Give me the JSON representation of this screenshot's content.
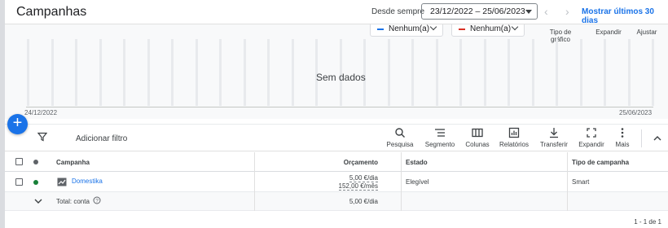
{
  "header": {
    "title": "Campanhas",
    "since_label": "Desde sempre",
    "date_range": "23/12/2022 – 25/06/2023",
    "show_last": "Mostrar últimos 30 dias"
  },
  "chart": {
    "metric1": "Nenhum(a)",
    "metric2": "Nenhum(a)",
    "metric1_color": "#1a73e8",
    "metric2_color": "#d93025",
    "tools": [
      "Tipo de gráfico",
      "Expandir",
      "Ajustar"
    ],
    "no_data": "Sem dados",
    "x_start": "24/12/2022",
    "x_end": "25/06/2023"
  },
  "toolbar": {
    "add_filter": "Adicionar filtro",
    "buttons": [
      "Pesquisa",
      "Segmento",
      "Colunas",
      "Relatórios",
      "Transferir",
      "Expandir",
      "Mais"
    ]
  },
  "table": {
    "columns": [
      "Campanha",
      "Orçamento",
      "Estado",
      "Tipo de campanha"
    ],
    "rows": [
      {
        "name": "Domestika",
        "budget_day": "5,00 €/dia",
        "budget_month": "152,00 €/mês",
        "status": "Elegível",
        "type": "Smart",
        "status_color": "#188038"
      }
    ],
    "total": {
      "label": "Total: conta",
      "budget": "5,00 €/dia"
    }
  },
  "pagination": "1 - 1 de 1"
}
